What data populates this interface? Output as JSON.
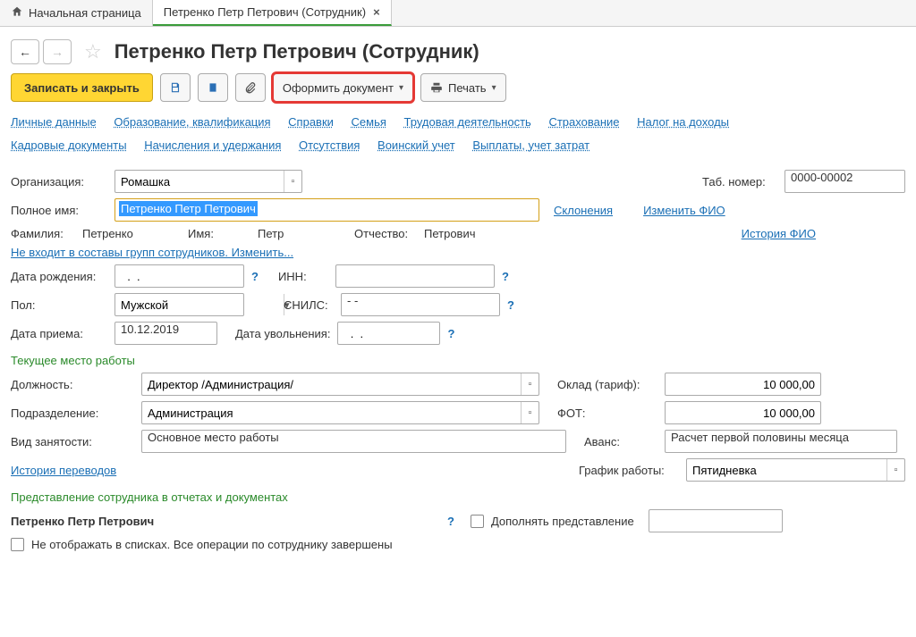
{
  "tabs": {
    "home": "Начальная страница",
    "current": "Петренко Петр Петрович (Сотрудник)"
  },
  "title": "Петренко Петр Петрович (Сотрудник)",
  "toolbar": {
    "save_close": "Записать и закрыть",
    "create_doc": "Оформить документ",
    "print": "Печать"
  },
  "navlinks": {
    "row1": [
      "Личные данные",
      "Образование, квалификация",
      "Справки",
      "Семья",
      "Трудовая деятельность",
      "Страхование",
      "Налог на доходы"
    ],
    "row2": [
      "Кадровые документы",
      "Начисления и удержания",
      "Отсутствия",
      "Воинский учет",
      "Выплаты, учет затрат"
    ]
  },
  "labels": {
    "org": "Организация:",
    "tabnum": "Таб. номер:",
    "fullname": "Полное имя:",
    "decl": "Склонения",
    "change_fio": "Изменить ФИО",
    "lname": "Фамилия:",
    "fname": "Имя:",
    "mname": "Отчество:",
    "history_fio": "История ФИО",
    "not_in_groups": "Не входит в составы групп сотрудников. Изменить...",
    "birthdate": "Дата рождения:",
    "inn": "ИНН:",
    "gender": "Пол:",
    "snils": "СНИЛС:",
    "hire_date": "Дата приема:",
    "fire_date": "Дата увольнения:",
    "current_job": "Текущее место работы",
    "position": "Должность:",
    "salary": "Оклад (тариф):",
    "dept": "Подразделение:",
    "fot": "ФОТ:",
    "emp_type": "Вид занятости:",
    "advance": "Аванс:",
    "transfer_history": "История переводов",
    "schedule": "График работы:",
    "repr_title": "Представление сотрудника в отчетах и документах",
    "repr_name": "Петренко Петр Петрович",
    "supplement": "Дополнять представление",
    "hide_lists": "Не отображать в списках. Все операции по сотруднику завершены"
  },
  "values": {
    "org": "Ромашка",
    "tabnum": "0000-00002",
    "fullname": "Петренко Петр Петрович",
    "lname": "Петренко",
    "fname": "Петр",
    "mname": "Петрович",
    "birthdate": "  .  .    ",
    "inn": "",
    "gender": "Мужской",
    "snils": "   -   -       ",
    "hire_date": "10.12.2019",
    "fire_date": "  .  .    ",
    "position": "Директор /Администрация/",
    "salary": "10 000,00",
    "dept": "Администрация",
    "fot": "10 000,00",
    "emp_type": "Основное место работы",
    "advance": "Расчет первой половины месяца",
    "schedule": "Пятидневка"
  }
}
